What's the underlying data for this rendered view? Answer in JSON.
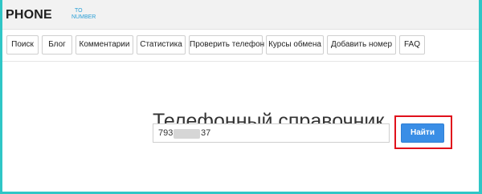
{
  "colors": {
    "frame_border": "#2fc6c6",
    "header_bg": "#f2f2f2",
    "accent_blue": "#3a8ee6",
    "highlight_red": "#e0111b"
  },
  "header": {
    "logo_main": "PHONE",
    "logo_sub_top": "TO",
    "logo_sub_bottom": "NUMBER"
  },
  "nav": {
    "items": [
      {
        "label": "Поиск"
      },
      {
        "label": "Блог"
      },
      {
        "label": "Комментарии"
      },
      {
        "label": "Статистика"
      },
      {
        "label": "Проверить телефон"
      },
      {
        "label": "Курсы обмена"
      },
      {
        "label": "Добавить номер"
      },
      {
        "label": "FAQ"
      }
    ]
  },
  "main": {
    "title": "Телефонный справочник",
    "search": {
      "value_prefix": "793",
      "value_suffix": "37",
      "button_label": "Найти"
    }
  }
}
